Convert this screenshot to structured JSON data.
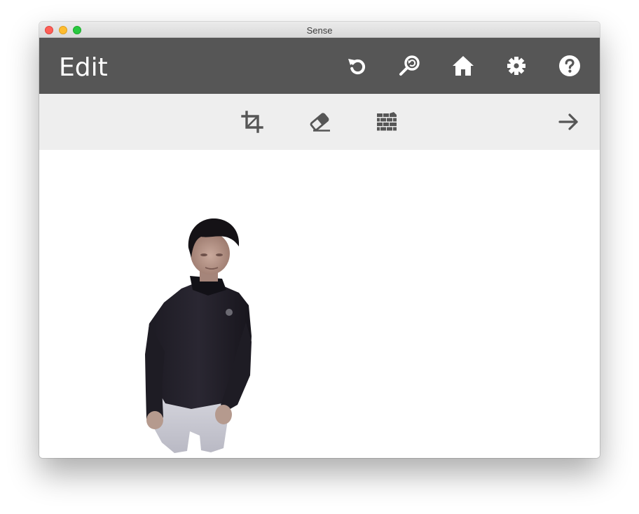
{
  "window": {
    "title": "Sense"
  },
  "header": {
    "title": "Edit",
    "background_color": "#565656",
    "actions": [
      {
        "icon": "undo-icon",
        "name": "undo-button"
      },
      {
        "icon": "zoom-reset-icon",
        "name": "zoom-button"
      },
      {
        "icon": "home-icon",
        "name": "home-button"
      },
      {
        "icon": "gear-icon",
        "name": "settings-button"
      },
      {
        "icon": "help-icon",
        "name": "help-button"
      }
    ]
  },
  "toolbar": {
    "background_color": "#eeeeee",
    "tools": [
      {
        "icon": "crop-icon",
        "name": "crop-tool"
      },
      {
        "icon": "eraser-icon",
        "name": "erase-tool"
      },
      {
        "icon": "brick-wall-icon",
        "name": "solidify-tool"
      }
    ],
    "next": {
      "icon": "arrow-right-icon",
      "name": "next-button"
    }
  },
  "viewport": {
    "content": "3d-scan-person"
  }
}
